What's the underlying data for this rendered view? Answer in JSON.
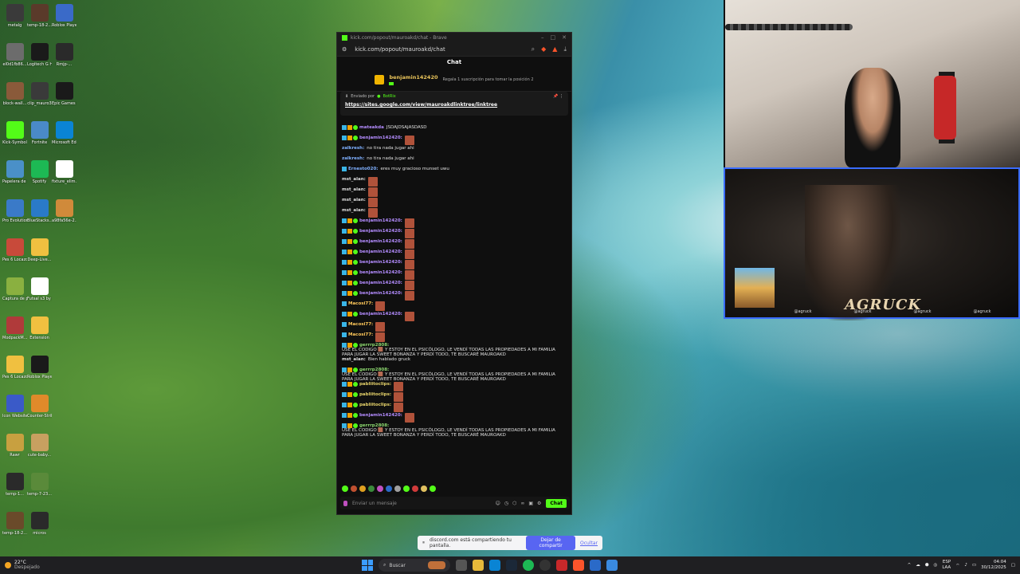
{
  "desktop": {
    "icons": [
      {
        "label": "metalg",
        "color": "#3a3a3a"
      },
      {
        "label": "el0d1fb86...",
        "color": "#6c6c6c"
      },
      {
        "label": "block-wall...",
        "color": "#8a5a3a"
      },
      {
        "label": "Kick-Symbol",
        "color": "#53fc18"
      },
      {
        "label": "Papelera de reciclaje",
        "color": "#4a90c8"
      },
      {
        "label": "Pro Evolution Soccer 6",
        "color": "#3a7ac8"
      },
      {
        "label": "Pes 6 Locazos",
        "color": "#c84a3a"
      },
      {
        "label": "Captura de pantalla 2...",
        "color": "#8ab040"
      },
      {
        "label": "ModpackM...",
        "color": "#b03a3a"
      },
      {
        "label": "Pes 6 Locazos",
        "color": "#f0c040"
      },
      {
        "label": "Icon Websites",
        "color": "#3a5ac8"
      },
      {
        "label": "Rawr",
        "color": "#c8a040"
      },
      {
        "label": "temp-1...",
        "color": "#2a2a2a"
      },
      {
        "label": "temp-18-2...",
        "color": "#6a4a2a"
      },
      {
        "label": "temp-18-2...",
        "color": "#5a3a2a"
      },
      {
        "label": "Logitech G HUB",
        "color": "#1a1a1a"
      },
      {
        "label": "clip_mauro3",
        "color": "#3a3a3a"
      },
      {
        "label": "Fortnite",
        "color": "#4a8ac8"
      },
      {
        "label": "Spotify",
        "color": "#1db954"
      },
      {
        "label": "BlueStacks...",
        "color": "#2a7ac8"
      },
      {
        "label": "Deep-Live...",
        "color": "#f0c040"
      },
      {
        "label": "Futsal s3 by Bachinga ...",
        "color": "#fff"
      },
      {
        "label": "Extension",
        "color": "#f0c040"
      },
      {
        "label": "Roblox Player",
        "color": "#1a1a1a"
      },
      {
        "label": "Counter-Strike",
        "color": "#e08a2a"
      },
      {
        "label": "cute-baby...",
        "color": "#c8a060"
      },
      {
        "label": "temp-7-23...",
        "color": "#5a8a3a"
      },
      {
        "label": "micros",
        "color": "#2a2a2a"
      },
      {
        "label": "Roblox Player",
        "color": "#3a6ac8"
      },
      {
        "label": "Rmjp-...",
        "color": "#2a2a2a"
      },
      {
        "label": "Epic Games Launcher",
        "color": "#1a1a1a"
      },
      {
        "label": "Microsoft Edge",
        "color": "#0a84d4"
      },
      {
        "label": "fixture_elim...",
        "color": "#fff"
      },
      {
        "label": "a98fa56e-2...",
        "color": "#d08a3a"
      }
    ]
  },
  "browser": {
    "tab_title": "kick.com/popout/mauroakd/chat - Brave",
    "url": "kick.com/popout/mauroakd/chat",
    "chat_title": "Chat",
    "sub_banner": {
      "user": "benjamin142420",
      "message": "Regala 1 suscripción para tomar la posición 2"
    },
    "pinned": {
      "header": "Enviado por",
      "by": "BotRix",
      "link": "https://sites.google.com/view/mauroakdlinktree/linktree"
    },
    "messages": [
      {
        "user": "mateakda",
        "color": "u-violet",
        "text": "JSDAJDSAJASDASD",
        "badges": 3
      },
      {
        "user": "benjamin142420:",
        "color": "u-violet",
        "emote": true,
        "badges": 3
      },
      {
        "user": "zalkresh:",
        "color": "u-blue",
        "text": "no tira nada jugar ahi",
        "badges": 0
      },
      {
        "user": "zalkresh:",
        "color": "u-blue",
        "text": "no tira nada jugar ahi",
        "badges": 0
      },
      {
        "user": "Ernesto020:",
        "color": "u-blue",
        "text": "eres muy gracioso munset uwu",
        "badges": 1
      },
      {
        "user": "mst_alan:",
        "color": "u-white",
        "emote": true,
        "badges": 0
      },
      {
        "user": "mst_alan:",
        "color": "u-white",
        "emote": true,
        "badges": 0
      },
      {
        "user": "mst_alan:",
        "color": "u-white",
        "emote": true,
        "badges": 0
      },
      {
        "user": "mst_alan:",
        "color": "u-white",
        "emote": true,
        "badges": 0
      },
      {
        "user": "benjamin142420:",
        "color": "u-violet",
        "emote": true,
        "badges": 3
      },
      {
        "user": "benjamin142420:",
        "color": "u-violet",
        "emote": true,
        "badges": 3
      },
      {
        "user": "benjamin142420:",
        "color": "u-violet",
        "emote": true,
        "badges": 3
      },
      {
        "user": "benjamin142420:",
        "color": "u-violet",
        "emote": true,
        "badges": 3
      },
      {
        "user": "benjamin142420:",
        "color": "u-violet",
        "emote": true,
        "badges": 3
      },
      {
        "user": "benjamin142420:",
        "color": "u-violet",
        "emote": true,
        "badges": 3
      },
      {
        "user": "benjamin142420:",
        "color": "u-violet",
        "emote": true,
        "badges": 3
      },
      {
        "user": "benjamin142420:",
        "color": "u-violet",
        "emote": true,
        "badges": 3
      },
      {
        "user": "Macosi77:",
        "color": "u-gold",
        "emote": true,
        "badges": 1
      },
      {
        "user": "benjamin142420:",
        "color": "u-violet",
        "emote": true,
        "badges": 3
      },
      {
        "user": "Macosi77:",
        "color": "u-gold",
        "emote": true,
        "badges": 1
      },
      {
        "user": "Macosi77:",
        "color": "u-gold",
        "emote": true,
        "badges": 1
      },
      {
        "user": "gerrrp2808:",
        "color": "u-green",
        "text": "USE EL CODIGO 🟫 Y ESTOY EN EL PSICÓLOGO, LE VENDÍ TODAS LAS PROPIEDADES A MI FAMILIA PARA JUGAR LA SWEET BONANZA Y PERDÍ TODO, TE BUSCARÉ MAUROAKD",
        "badges": 3,
        "long": true
      },
      {
        "user": "mst_alan:",
        "color": "u-white",
        "text": "Bien hablado gruck",
        "badges": 0
      },
      {
        "user": "gerrrp2808:",
        "color": "u-green",
        "text": "USE EL CODIGO 🟫 Y ESTOY EN EL PSICÓLOGO, LE VENDÍ TODAS LAS PROPIEDADES A MI FAMILIA PARA JUGAR LA SWEET BONANZA Y PERDÍ TODO, TE BUSCARÉ MAUROAKD",
        "badges": 3,
        "long": true
      },
      {
        "user": "pabliitoclips:",
        "color": "u-yellow",
        "emote": true,
        "badges": 3
      },
      {
        "user": "pabliitoclips:",
        "color": "u-yellow",
        "emote": true,
        "badges": 3
      },
      {
        "user": "pabliitoclips:",
        "color": "u-yellow",
        "emote": true,
        "badges": 3
      },
      {
        "user": "benjamin142420:",
        "color": "u-violet",
        "emote": true,
        "badges": 3
      },
      {
        "user": "gerrrp2808:",
        "color": "u-green",
        "text": "USE EL CODIGO 🟫 Y ESTOY EN EL PSICÓLOGO, LE VENDÍ TODAS LAS PROPIEDADES A MI FAMILIA PARA JUGAR LA SWEET BONANZA Y PERDÍ TODO, TE BUSCARÉ MAUROAKD",
        "badges": 3,
        "long": true
      }
    ],
    "input_placeholder": "Enviar un mensaje",
    "send_label": "Chat"
  },
  "webcam": {
    "overlay_text": "AGRUCK",
    "socials": [
      "@agruck",
      "@agruck",
      "@agruck",
      "@agruck"
    ]
  },
  "share_notification": {
    "text": "discord.com está compartiendo tu pantalla.",
    "stop_label": "Dejar de compartir",
    "hide_label": "Ocultar"
  },
  "taskbar": {
    "weather_temp": "22°C",
    "weather_desc": "Despejado",
    "search_placeholder": "Buscar",
    "lang_top": "ESP",
    "lang_bottom": "LAA",
    "time": "04:04",
    "date": "30/12/2025"
  },
  "colors": {
    "kick_green": "#53fc18",
    "discord_blurple": "#5865f2"
  }
}
